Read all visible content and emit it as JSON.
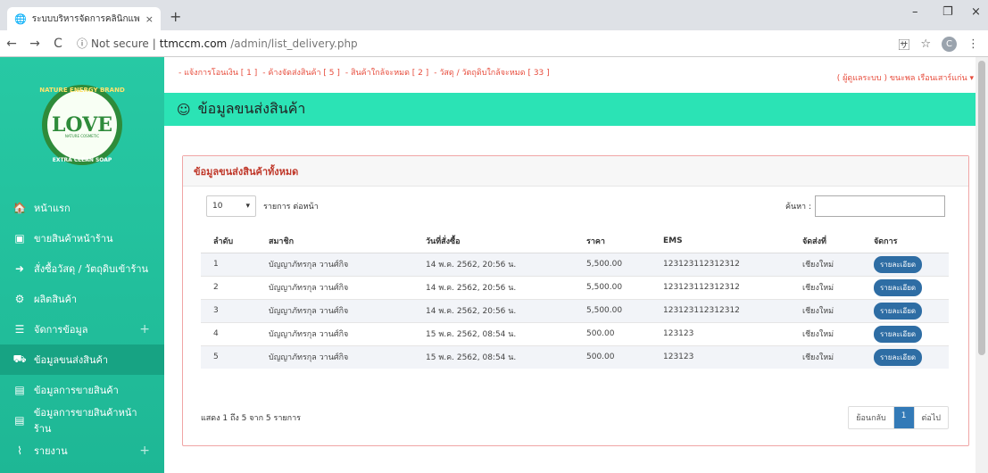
{
  "browser": {
    "tab_title": "ระบบบริหารจัดการคลินิกแพทย์แผนไทย",
    "close_glyph": "×",
    "new_tab_glyph": "+",
    "window_controls": [
      "–",
      "❐",
      "×"
    ],
    "security_label": "Not secure",
    "url_domain": "ttmccm.com",
    "url_path": "/admin/list_delivery.php",
    "profile_initial": "C"
  },
  "logo": {
    "word": "LOVE",
    "arc_top": "NATURE ENERGY BRAND",
    "arc_bottom": "EXTRA CLEAN SOAP",
    "sub": "NATURE COSMETIC"
  },
  "sidebar": {
    "items": [
      {
        "label": "หน้าแรก",
        "icon": "home-icon",
        "glyph": "🏠",
        "plus": ""
      },
      {
        "label": "ขายสินค้าหน้าร้าน",
        "icon": "cash-register-icon",
        "glyph": "▣",
        "plus": ""
      },
      {
        "label": "สั่งซื้อวัสดุ / วัตถุดิบเข้าร้าน",
        "icon": "sign-in-icon",
        "glyph": "➜",
        "plus": ""
      },
      {
        "label": "ผลิตสินค้า",
        "icon": "gear-icon",
        "glyph": "⚙",
        "plus": ""
      },
      {
        "label": "จัดการข้อมูล",
        "icon": "list-icon",
        "glyph": "☰",
        "plus": "+"
      },
      {
        "label": "ข้อมูลขนส่งสินค้า",
        "icon": "truck-icon",
        "glyph": "⛟",
        "plus": ""
      },
      {
        "label": "ข้อมูลการขายสินค้า",
        "icon": "document-icon",
        "glyph": "▤",
        "plus": ""
      },
      {
        "label": "ข้อมูลการขายสินค้าหน้าร้าน",
        "icon": "document-icon",
        "glyph": "▤",
        "plus": ""
      },
      {
        "label": "รายงาน",
        "icon": "chart-icon",
        "glyph": "⌇",
        "plus": "+"
      }
    ]
  },
  "topbar": {
    "alerts": [
      "- แจ้งการโอนเงิน [ 1 ]",
      "- ค้างจัดส่งสินค้า [ 5 ]",
      "- สินค้าใกล้จะหมด [ 2 ]",
      "- วัสดุ / วัตถุดิบใกล้จะหมด [ 33 ]"
    ],
    "user": "( ผู้ดูแลระบบ ) ขนะพล เรือนเสาร์แก่น ▾"
  },
  "page": {
    "title": "ข้อมูลขนส่งสินค้า",
    "title_glyph": "☺",
    "panel_title": "ข้อมูลขนส่งสินค้าทั้งหมด"
  },
  "controls": {
    "length_value": "10",
    "length_label": "รายการ ต่อหน้า",
    "search_label": "ค้นหา :",
    "search_value": ""
  },
  "table": {
    "headers": [
      "ลำดับ",
      "สมาชิก",
      "วันที่สั่งซื้อ",
      "ราคา",
      "EMS",
      "จัดส่งที่",
      "จัดการ"
    ],
    "rows": [
      [
        "1",
        "บัญญาภัทรกุล วานศ์กิจ",
        "14 พ.ค. 2562, 20:56 น.",
        "5,500.00",
        "123123112312312",
        "เชียงใหม่",
        "รายละเอียด"
      ],
      [
        "2",
        "บัญญาภัทรกุล วานศ์กิจ",
        "14 พ.ค. 2562, 20:56 น.",
        "5,500.00",
        "123123112312312",
        "เชียงใหม่",
        "รายละเอียด"
      ],
      [
        "3",
        "บัญญาภัทรกุล วานศ์กิจ",
        "14 พ.ค. 2562, 20:56 น.",
        "5,500.00",
        "123123112312312",
        "เชียงใหม่",
        "รายละเอียด"
      ],
      [
        "4",
        "บัญญาภัทรกุล วานศ์กิจ",
        "15 พ.ค. 2562, 08:54 น.",
        "500.00",
        "123123",
        "เชียงใหม่",
        "รายละเอียด"
      ],
      [
        "5",
        "บัญญาภัทรกุล วานศ์กิจ",
        "15 พ.ค. 2562, 08:54 น.",
        "500.00",
        "123123",
        "เชียงใหม่",
        "รายละเอียด"
      ]
    ],
    "info": "แสดง 1 ถึง 5 จาก 5 รายการ",
    "pager": {
      "prev": "ย้อนกลับ",
      "current": "1",
      "next": "ต่อไป"
    }
  },
  "colors": {
    "sidebar": "#1ec8a0",
    "header": "#2be3b5",
    "alert": "#e74c3c",
    "button": "#2e6da4"
  }
}
